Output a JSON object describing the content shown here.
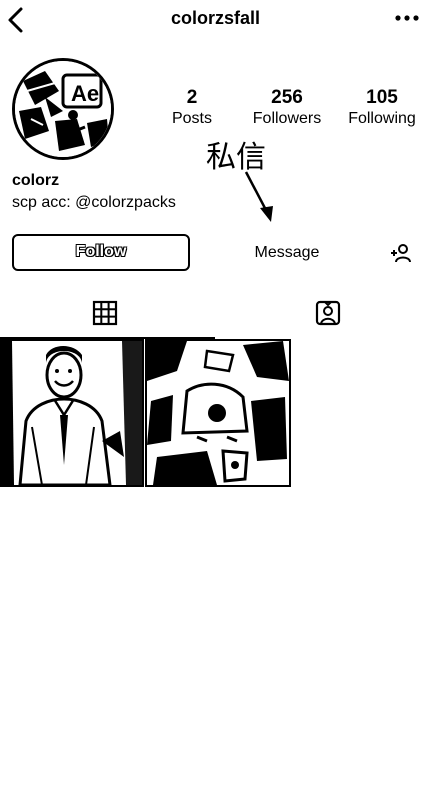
{
  "header": {
    "username": "colorzsfall"
  },
  "profile": {
    "display_name": "colorz",
    "bio": "scp acc: @colorzpacks",
    "avatar_text": "Ae"
  },
  "stats": [
    {
      "value": "2",
      "label": "Posts"
    },
    {
      "value": "256",
      "label": "Followers"
    },
    {
      "value": "105",
      "label": "Following"
    }
  ],
  "annotation": {
    "text": "私信"
  },
  "actions": {
    "follow_label": "Follow",
    "message_label": "Message"
  },
  "tabs": {
    "active": "grid"
  },
  "colors": {
    "ink": "#000000",
    "background": "#ffffff"
  }
}
